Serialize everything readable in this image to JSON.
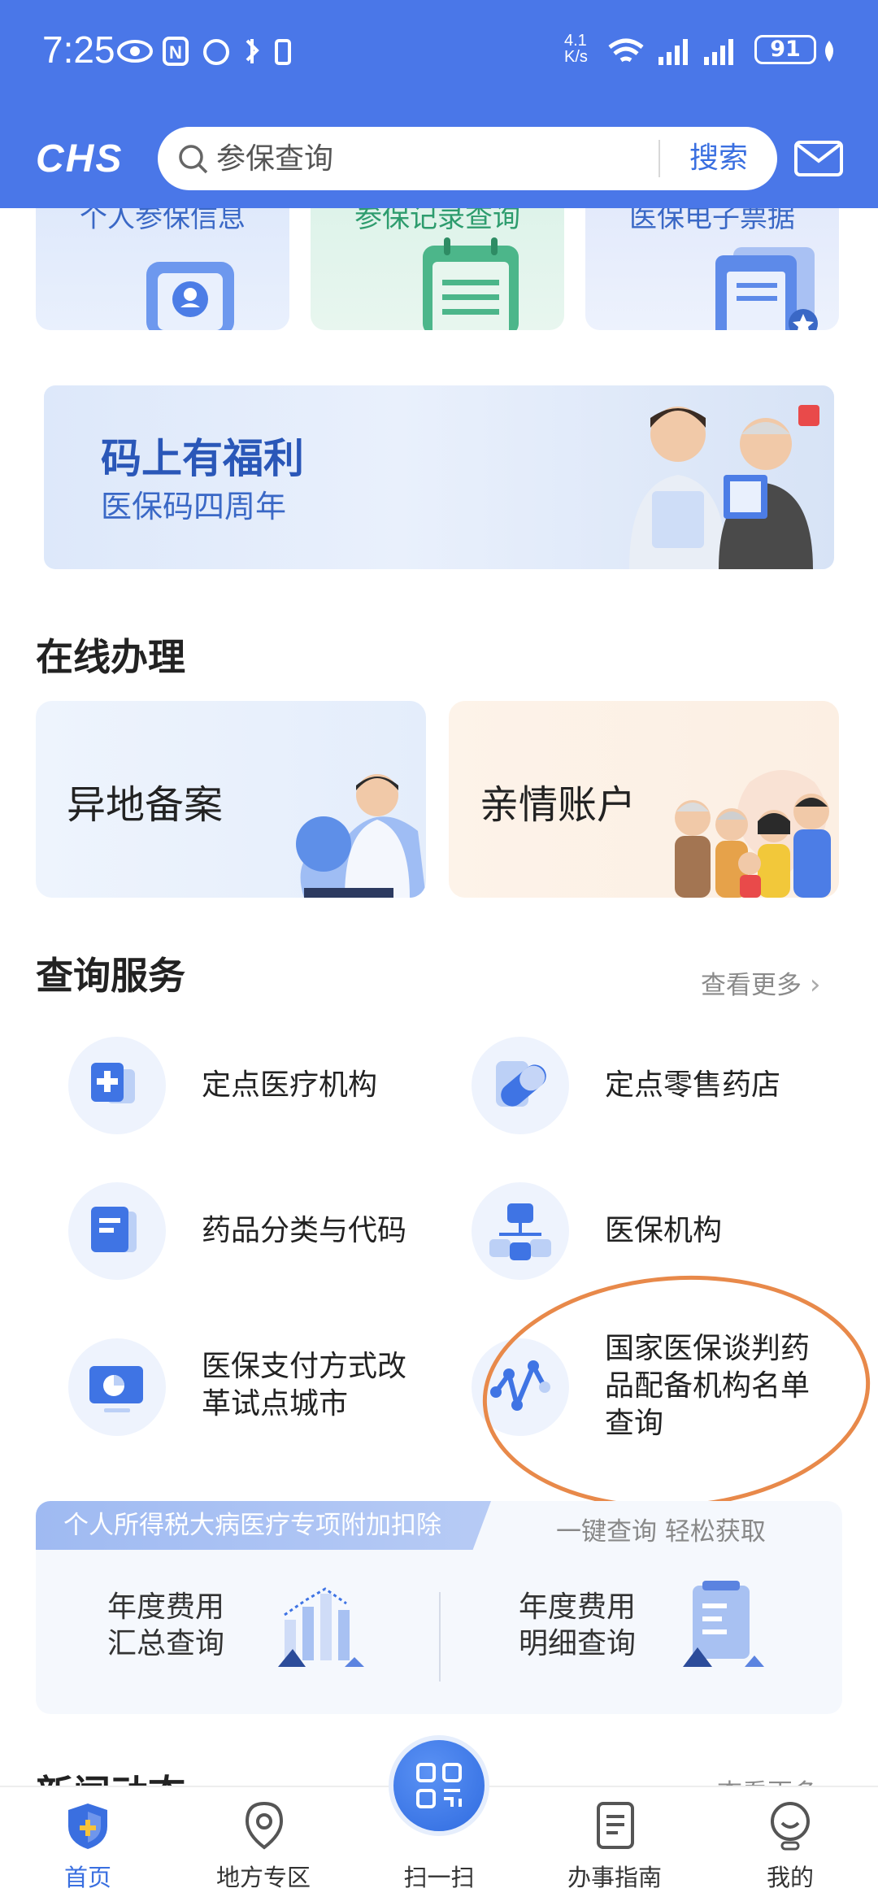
{
  "status_bar": {
    "time": "7:25",
    "net_speed": "4.1\nK/s",
    "battery": "91"
  },
  "header": {
    "logo": "CHS",
    "search_placeholder": "参保查询",
    "search_button": "搜索"
  },
  "top_cards": [
    {
      "label": "个人参保信息"
    },
    {
      "label": "参保记录查询"
    },
    {
      "label": "医保电子票据"
    }
  ],
  "banner": {
    "title": "码上有福利",
    "subtitle": "医保码四周年"
  },
  "online": {
    "title": "在线办理",
    "cards": [
      {
        "label": "异地备案"
      },
      {
        "label": "亲情账户"
      }
    ]
  },
  "query": {
    "title": "查询服务",
    "more": "查看更多",
    "items": [
      {
        "label": "定点医疗机构",
        "icon": "hospital-icon"
      },
      {
        "label": "定点零售药店",
        "icon": "pill-icon"
      },
      {
        "label": "药品分类与代码",
        "icon": "document-icon"
      },
      {
        "label": "医保机构",
        "icon": "org-chart-icon"
      },
      {
        "label": "医保支付方式改\n革试点城市",
        "icon": "monitor-icon"
      },
      {
        "label": "国家医保谈判药\n品配备机构名单\n查询",
        "icon": "network-icon"
      }
    ]
  },
  "tax": {
    "tag": "个人所得税大病医疗专项附加扣除",
    "slogan": "一键查询 轻松获取",
    "items": [
      {
        "label": "年度费用\n汇总查询"
      },
      {
        "label": "年度费用\n明细查询"
      }
    ]
  },
  "news": {
    "title": "新闻动态",
    "more": "查看更多"
  },
  "nav": {
    "items": [
      {
        "label": "首页",
        "active": true
      },
      {
        "label": "地方专区"
      },
      {
        "label": "扫一扫"
      },
      {
        "label": "办事指南"
      },
      {
        "label": "我的"
      }
    ]
  },
  "colors": {
    "header": "#4a77e8",
    "accent": "#2f6be0",
    "highlight_circle": "#e8894a"
  }
}
